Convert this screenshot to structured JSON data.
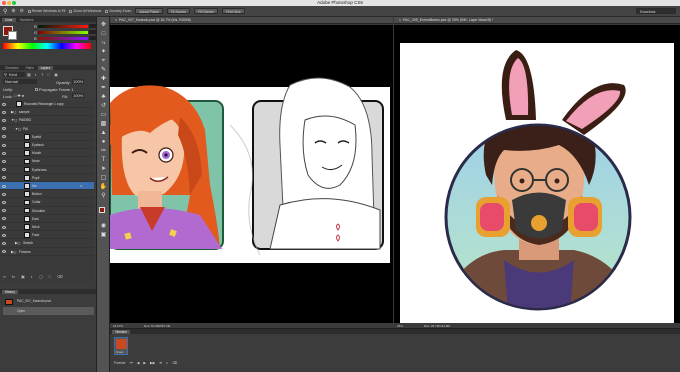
{
  "app": {
    "title": "Adobe Photoshop CS6"
  },
  "options_bar": {
    "resize_windows": "Resize Windows to Fit",
    "zoom_all_windows": "Zoom All Windows",
    "scrubby_zoom": "Scrubby Zoom",
    "actual_pixels": "Actual Pixels",
    "fit_screen": "Fit Screen",
    "fill_screen": "Fill Screen",
    "print_size": "Print Size",
    "workspace": "Essentials"
  },
  "color_panel": {
    "tabs": [
      "Color",
      "Swatches"
    ],
    "channels": [
      "R",
      "G",
      "B"
    ]
  },
  "layers_panel": {
    "tabs": [
      "Channels",
      "Paths",
      "Layers"
    ],
    "kind_filter": "Kind",
    "blend_mode": "Normal",
    "opacity_label": "Opacity:",
    "opacity_value": "100%",
    "unify_label": "Unify:",
    "propagate_label": "Propagate Frame 1",
    "lock_label": "Lock:",
    "fill_label": "Fill:",
    "fill_value": "100%",
    "layers": [
      "Rounded Rectangle 1 copy",
      "sample",
      "PAIDBG",
      "PAI",
      "Eyelid",
      "Eyelash",
      "Mouth",
      "Nose",
      "Eyebrows",
      "Pupil",
      "Iris",
      "Button",
      "Collar",
      "Shoulder",
      "Ears",
      "Neck",
      "Face",
      "Sketch",
      "Flowers"
    ]
  },
  "history_panel": {
    "tab": "History",
    "snapshot": "PAC_007_Kwando.psd",
    "step": "Open"
  },
  "doc_left": {
    "tab": "PAC_007_Kwando.psd @ 16.7% (Iris, RGB/8)",
    "zoom": "16.67%",
    "doc_info": "Doc: 51.5M/597.3M"
  },
  "doc_right": {
    "tab": "PAC_005_ErnestBanes.psd @ 25% (INK, Layer Mask/8) *",
    "zoom": "25%",
    "doc_info": "Doc: 29.7M/413.8M"
  },
  "timeline": {
    "tab": "Timeline",
    "frame_time": "0 sec.",
    "loop": "Forever"
  },
  "colors": {
    "accent": "#3b6fb0",
    "panel": "#3c3c3c",
    "canvas_bg": "#000000"
  }
}
